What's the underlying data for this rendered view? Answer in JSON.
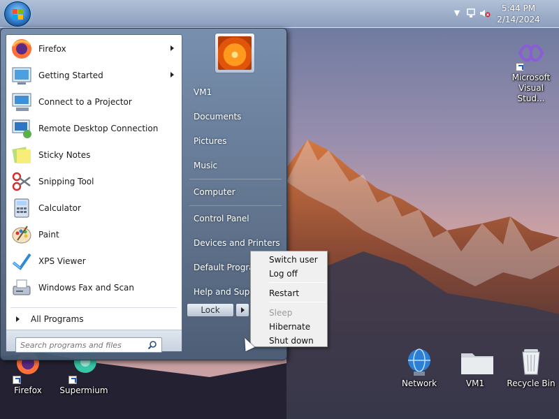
{
  "taskbar": {
    "time": "5:44 PM",
    "date": "2/14/2024"
  },
  "start_menu": {
    "programs": [
      {
        "label": "Firefox",
        "icon": "firefox-icon",
        "has_submenu": true
      },
      {
        "label": "Getting Started",
        "icon": "getting-started-icon",
        "has_submenu": true
      },
      {
        "label": "Connect to a Projector",
        "icon": "projector-icon",
        "has_submenu": false
      },
      {
        "label": "Remote Desktop Connection",
        "icon": "remote-desktop-icon",
        "has_submenu": false
      },
      {
        "label": "Sticky Notes",
        "icon": "sticky-notes-icon",
        "has_submenu": false
      },
      {
        "label": "Snipping Tool",
        "icon": "scissors-icon",
        "has_submenu": false
      },
      {
        "label": "Calculator",
        "icon": "calculator-icon",
        "has_submenu": false
      },
      {
        "label": "Paint",
        "icon": "paint-palette-icon",
        "has_submenu": false
      },
      {
        "label": "XPS Viewer",
        "icon": "xps-viewer-icon",
        "has_submenu": false
      },
      {
        "label": "Windows Fax and Scan",
        "icon": "fax-icon",
        "has_submenu": false
      }
    ],
    "all_programs": "All Programs",
    "search_placeholder": "Search programs and files",
    "places": [
      "VM1",
      "Documents",
      "Pictures",
      "Music",
      "Computer",
      "Control Panel",
      "Devices and Printers",
      "Default Programs",
      "Help and Support"
    ],
    "lock_label": "Lock"
  },
  "context_menu": {
    "items": [
      {
        "label": "Switch user",
        "disabled": false
      },
      {
        "label": "Log off",
        "disabled": false
      },
      {
        "label": "Restart",
        "disabled": false
      },
      {
        "label": "Sleep",
        "disabled": true
      },
      {
        "label": "Hibernate",
        "disabled": false
      },
      {
        "label": "Shut down",
        "disabled": false
      }
    ]
  },
  "desktop_icons": {
    "visual_studio_line1": "Microsoft",
    "visual_studio_line2": "Visual Stud...",
    "firefox": "Firefox",
    "supermium": "Supermium",
    "network": "Network",
    "vm1": "VM1",
    "recycle_bin": "Recycle Bin"
  }
}
